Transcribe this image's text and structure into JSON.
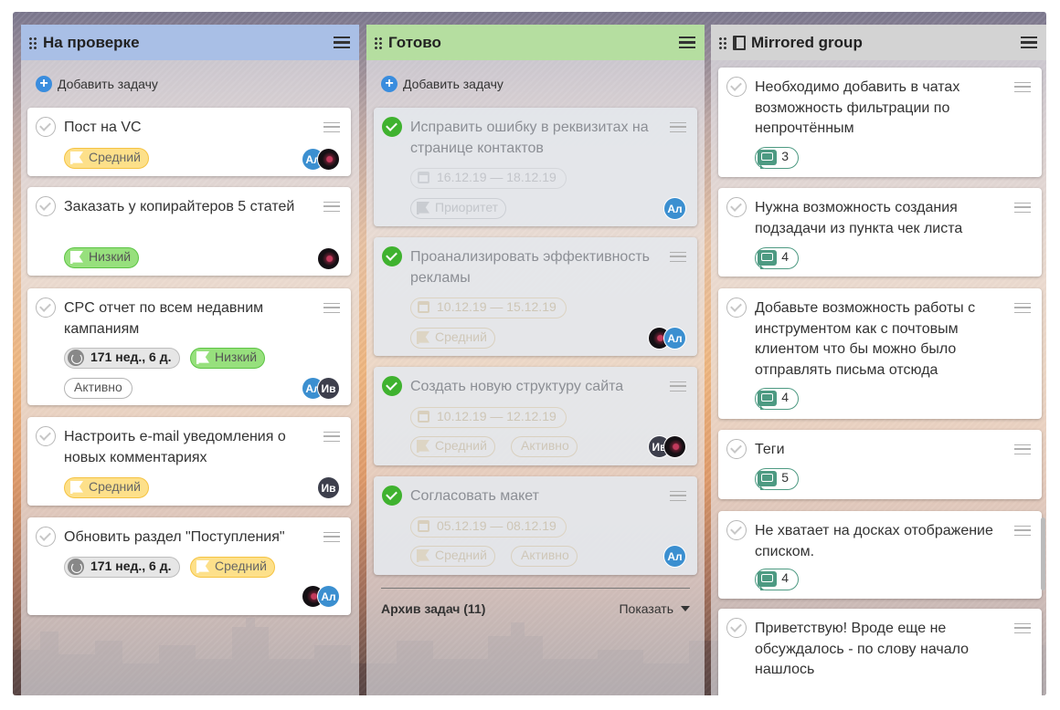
{
  "board": {
    "add_task_label": "Добавить задачу",
    "colors": {
      "review_header": "#a9bfe6",
      "done_header": "#b5dea0",
      "mirrored_header": "#d3d3d3",
      "medium_priority": "#fde08a",
      "low_priority": "#97e07d",
      "avatar_al": "#3b8fd0",
      "avatar_iv": "#3d3f4c",
      "done_check": "#3fb22f",
      "comment": "#4d9a82"
    }
  },
  "columns": [
    {
      "title": "На проверке",
      "cards": [
        {
          "title": "Пост на VC",
          "priority": "Средний",
          "avatars": [
            "Ал",
            ""
          ]
        },
        {
          "title": "Заказать у копирайтеров 5 статей",
          "priority": "Низкий",
          "avatars": [
            ""
          ]
        },
        {
          "title": "CPC отчет по всем недавним кампаниям",
          "time": "171 нед., 6 д.",
          "priority": "Низкий",
          "status": "Активно",
          "avatars": [
            "Ал",
            "Ив"
          ]
        },
        {
          "title": "Настроить e-mail уведомления о новых комментариях",
          "priority": "Средний",
          "avatars": [
            "Ив"
          ]
        },
        {
          "title": "Обновить раздел \"Поступления\"",
          "time": "171 нед., 6 д.",
          "priority": "Средний",
          "avatars": [
            "",
            "Ал"
          ]
        }
      ]
    },
    {
      "title": "Готово",
      "cards": [
        {
          "title": "Исправить ошибку в реквизитах на странице контактов",
          "dates": "16.12.19 — 18.12.19",
          "priority": "Приоритет",
          "avatars": [
            "Ал"
          ]
        },
        {
          "title": "Проанализировать эффективность рекламы",
          "dates": "10.12.19 — 15.12.19",
          "priority": "Средний",
          "avatars": [
            "",
            "Ал"
          ]
        },
        {
          "title": "Создать новую структуру сайта",
          "dates": "10.12.19 — 12.12.19",
          "priority": "Средний",
          "status": "Активно",
          "avatars": [
            "Ив",
            ""
          ]
        },
        {
          "title": "Согласовать макет",
          "dates": "05.12.19 — 08.12.19",
          "priority": "Средний",
          "status": "Активно",
          "avatars": [
            "Ал"
          ]
        }
      ],
      "archive": {
        "label": "Архив задач (11)",
        "show": "Показать"
      }
    },
    {
      "title": "Mirrored group",
      "cards": [
        {
          "title": "Необходимо добавить в чатах возможность фильтрации по непрочтённым",
          "comments": "3"
        },
        {
          "title": "Нужна возможность создания подзадачи из пункта чек листа",
          "comments": "4"
        },
        {
          "title": "Добавьте возможность работы с инструментом как с почтовым клиентом что бы можно было отправлять письма отсюда",
          "comments": "4"
        },
        {
          "title": "Теги",
          "comments": "5"
        },
        {
          "title": "Не хватает на досках отображение списком.",
          "comments": "4"
        },
        {
          "title": "Приветствую! Вроде еще не обсуждалось - по слову начало нашлось"
        }
      ]
    }
  ]
}
